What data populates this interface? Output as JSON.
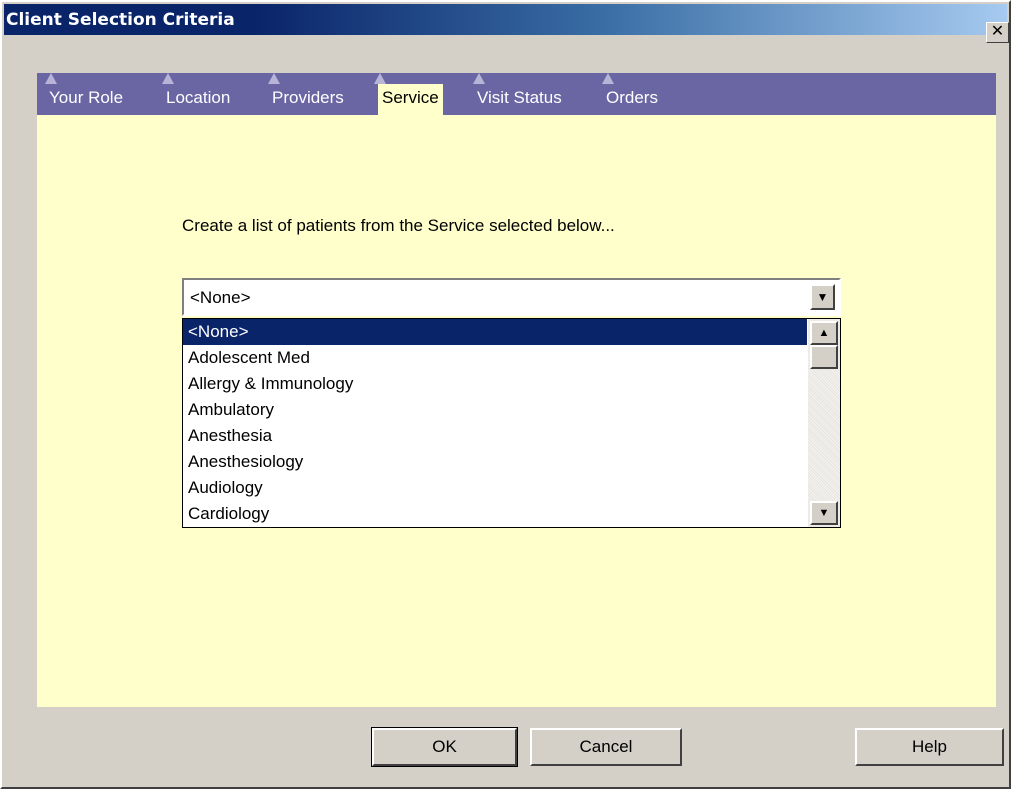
{
  "window": {
    "title": "Client Selection Criteria",
    "close_glyph": "✕"
  },
  "tabs": [
    {
      "label": "Your Role"
    },
    {
      "label": "Location"
    },
    {
      "label": "Providers"
    },
    {
      "label": "Service",
      "active": true
    },
    {
      "label": "Visit Status"
    },
    {
      "label": "Orders"
    }
  ],
  "service_panel": {
    "instruction": "Create a list of patients from the Service selected below...",
    "combo_value": "<None>",
    "options": [
      "<None>",
      "Adolescent Med",
      "Allergy & Immunology",
      "Ambulatory",
      "Anesthesia",
      "Anesthesiology",
      "Audiology",
      "Cardiology"
    ],
    "selected_option": "<None>"
  },
  "buttons": {
    "ok": "OK",
    "cancel": "Cancel",
    "help": "Help"
  },
  "icons": {
    "combo_arrow": "▼",
    "scroll_up": "▲",
    "scroll_down": "▼"
  },
  "colors": {
    "panel_bg": "#ffffcc",
    "tab_strip": "#6a66a4",
    "selection": "#0a246a",
    "title_start": "#0a246a"
  }
}
